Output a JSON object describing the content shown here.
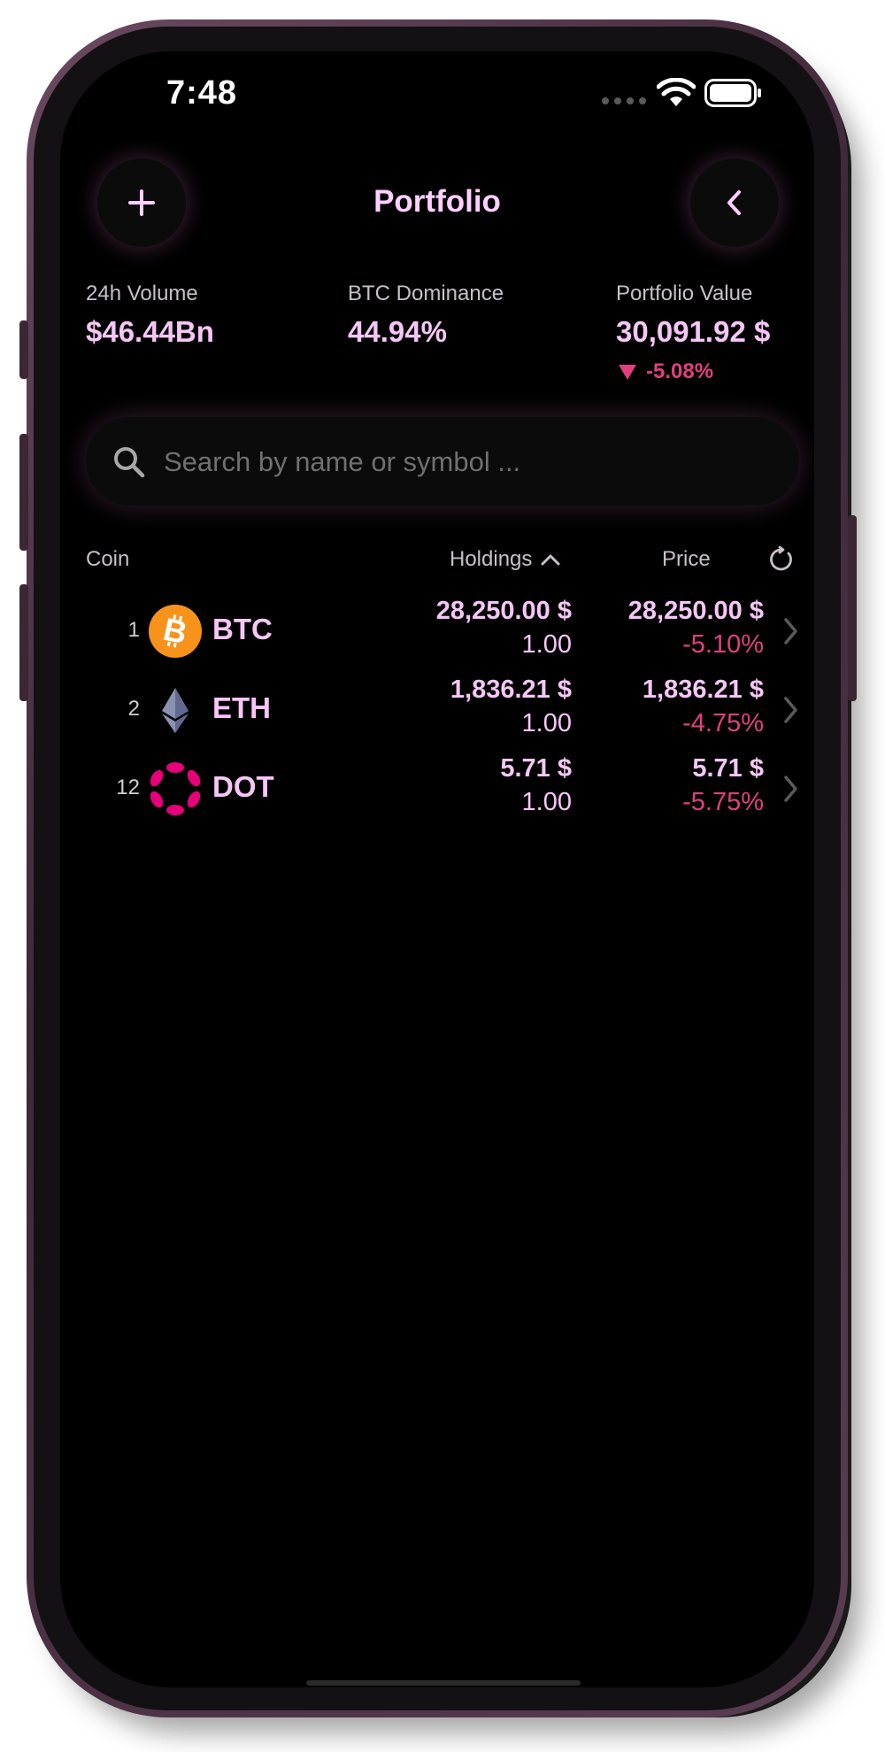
{
  "status_bar": {
    "time": "7:48"
  },
  "header": {
    "title": "Portfolio"
  },
  "stats": {
    "volume": {
      "label": "24h Volume",
      "value": "$46.44Bn"
    },
    "dominance": {
      "label": "BTC Dominance",
      "value": "44.94%"
    },
    "portfolio": {
      "label": "Portfolio Value",
      "value": "30,091.92 $",
      "change": "-5.08%"
    }
  },
  "search": {
    "placeholder": "Search by name or symbol ..."
  },
  "columns": {
    "coin": "Coin",
    "holdings": "Holdings",
    "price": "Price"
  },
  "coins": [
    {
      "rank": "1",
      "symbol": "BTC",
      "holding_value": "28,250.00 $",
      "holding_qty": "1.00",
      "price": "28,250.00 $",
      "change": "-5.10%"
    },
    {
      "rank": "2",
      "symbol": "ETH",
      "holding_value": "1,836.21 $",
      "holding_qty": "1.00",
      "price": "1,836.21 $",
      "change": "-4.75%"
    },
    {
      "rank": "12",
      "symbol": "DOT",
      "holding_value": "5.71 $",
      "holding_qty": "1.00",
      "price": "5.71 $",
      "change": "-5.75%"
    }
  ],
  "colors": {
    "accent": "#f6c6f6",
    "negative": "#e0407f",
    "btc": "#f7931a",
    "dot": "#e6007a",
    "eth": "#8a92b2"
  }
}
